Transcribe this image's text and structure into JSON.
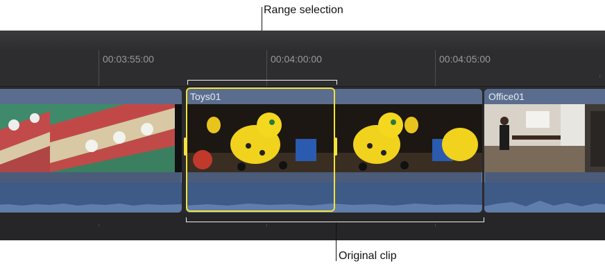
{
  "callouts": {
    "top": "Range selection",
    "bottom": "Original clip"
  },
  "ruler": {
    "timecodes": [
      "00:03:55:00",
      "00:04:00:00",
      "00:04:05:00"
    ]
  },
  "clips": [
    {
      "name": ""
    },
    {
      "name": "Toys01"
    },
    {
      "name": "Office01"
    }
  ],
  "colors": {
    "selection": "#f3e23b",
    "clip_blue": "#4a5c7a",
    "timeline_bg": "#2a2a2c"
  }
}
